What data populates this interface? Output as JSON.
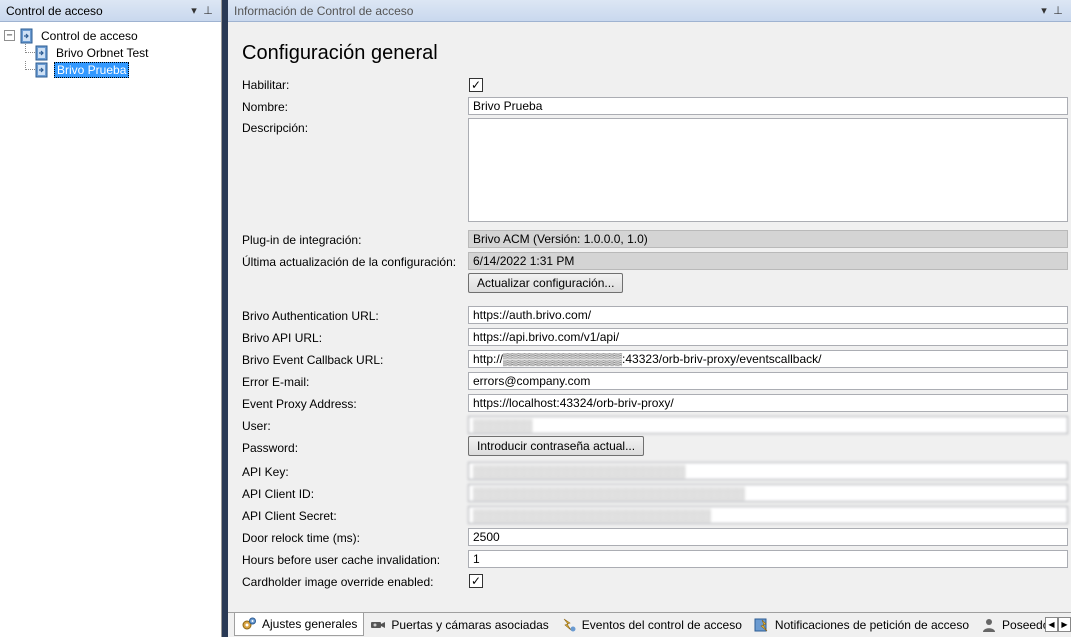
{
  "left_pane": {
    "title": "Control de acceso",
    "dropdown_glyph": "▾",
    "pin_glyph": "⊥",
    "tree": {
      "root_expander": "−",
      "root_label": "Control de acceso",
      "children": [
        {
          "label": "Brivo Orbnet Test",
          "selected": false
        },
        {
          "label": "Brivo Prueba",
          "selected": true
        }
      ]
    }
  },
  "right_pane": {
    "title": "Información de Control de acceso",
    "dropdown_glyph": "▾",
    "pin_glyph": "⊥",
    "section_title": "Configuración general",
    "fields": {
      "habilitar": {
        "label": "Habilitar:",
        "checked": true,
        "check_glyph": "✓"
      },
      "nombre": {
        "label": "Nombre:",
        "value": "Brivo Prueba"
      },
      "descripcion": {
        "label": "Descripción:",
        "value": ""
      },
      "plugin": {
        "label": "Plug-in de integración:",
        "value": "Brivo ACM (Versión: 1.0.0.0, 1.0)"
      },
      "ultima": {
        "label": "Última actualización de la configuración:",
        "value": "6/14/2022 1:31 PM"
      },
      "actualizar_button": "Actualizar configuración...",
      "auth_url": {
        "label": "Brivo Authentication URL:",
        "value": "https://auth.brivo.com/"
      },
      "api_url": {
        "label": "Brivo API URL:",
        "value": "https://api.brivo.com/v1/api/"
      },
      "callback_url": {
        "label": "Brivo Event Callback URL:",
        "value": "http://▒▒▒▒▒▒▒▒▒▒▒▒▒▒:43323/orb-briv-proxy/eventscallback/"
      },
      "error_email": {
        "label": "Error E-mail:",
        "value": "errors@company.com"
      },
      "proxy_address": {
        "label": "Event Proxy Address:",
        "value": "https://localhost:43324/orb-briv-proxy/"
      },
      "user": {
        "label": "User:",
        "value": "▒▒▒▒▒▒▒"
      },
      "password": {
        "label": "Password:",
        "button": "Introducir contraseña actual..."
      },
      "api_key": {
        "label": "API Key:",
        "value": "▒▒▒▒▒▒▒▒▒▒▒▒▒▒▒▒▒▒▒▒▒▒▒▒▒"
      },
      "api_client_id": {
        "label": "API Client ID:",
        "value": "▒▒▒▒▒▒▒▒▒▒▒▒▒▒▒▒▒▒▒▒▒▒▒▒▒▒▒▒▒▒▒▒"
      },
      "api_client_secret": {
        "label": "API Client Secret:",
        "value": "▒▒▒▒▒▒▒▒▒▒▒▒▒▒▒▒▒▒▒▒▒▒▒▒▒▒▒▒"
      },
      "door_relock": {
        "label": "Door relock time (ms):",
        "value": "2500"
      },
      "hours_cache": {
        "label": "Hours before user cache invalidation:",
        "value": "1"
      },
      "cardholder_override": {
        "label": "Cardholder image override enabled:",
        "checked": true,
        "check_glyph": "✓"
      }
    }
  },
  "tabs": [
    {
      "label": "Ajustes generales",
      "icon": "gears-icon",
      "active": true
    },
    {
      "label": "Puertas y cámaras asociadas",
      "icon": "camera-icon",
      "active": false
    },
    {
      "label": "Eventos del control de acceso",
      "icon": "events-icon",
      "active": false
    },
    {
      "label": "Notificaciones de petición de acceso",
      "icon": "notification-icon",
      "active": false
    },
    {
      "label": "Poseedo",
      "icon": "person-icon",
      "active": false
    }
  ],
  "tab_scroll": {
    "left": "◀",
    "right": "▶"
  },
  "colors": {
    "splitter": "#293955",
    "selection": "#3399ff",
    "header_bg": "#c9d8ee",
    "content_bg": "#f0f0f0"
  }
}
